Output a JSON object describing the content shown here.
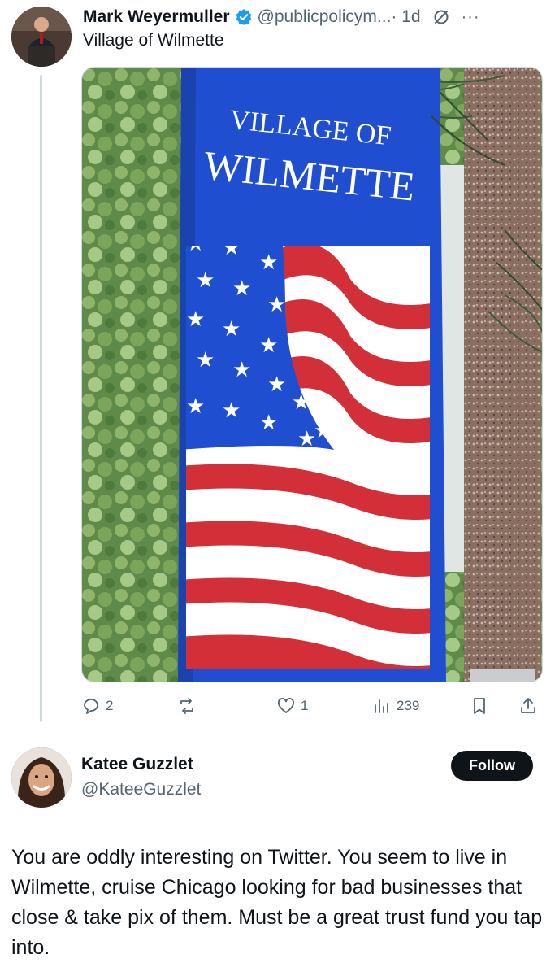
{
  "colors": {
    "accent": "#1d9bf0",
    "text": "#0f1419",
    "muted": "#536471",
    "line": "#cfd9de"
  },
  "post": {
    "author_name": "Mark Weyermuller",
    "handle": "@publicpolicym...",
    "time": "· 1d",
    "text": "Village of Wilmette",
    "image": {
      "banner_line1": "VILLAGE OF",
      "banner_line2": "WILMETTE"
    },
    "actions": {
      "replies": "2",
      "reposts": "",
      "likes": "1",
      "views": "239"
    },
    "icons": [
      "verified-icon",
      "grok-icon",
      "more-icon",
      "reply-icon",
      "repost-icon",
      "like-icon",
      "views-icon",
      "bookmark-icon",
      "share-icon"
    ]
  },
  "reply": {
    "author_name": "Katee Guzzlet",
    "handle": "@KateeGuzzlet",
    "follow_label": "Follow",
    "text": "You are oddly interesting on Twitter. You seem to live in Wilmette, cruise Chicago looking for bad businesses that close & take pix of them. Must be a great trust fund you tap into."
  }
}
